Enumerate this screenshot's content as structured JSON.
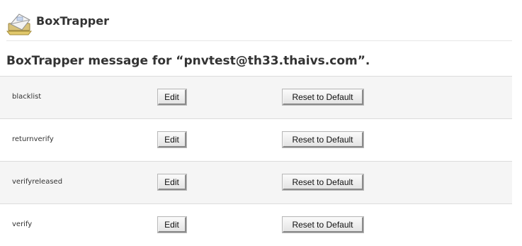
{
  "header": {
    "app_icon": "boxtrapper-envelope-icon",
    "title": "BoxTrapper"
  },
  "page": {
    "title": "BoxTrapper message for “pnvtest@th33.thaivs.com”."
  },
  "messages": [
    {
      "name": "blacklist",
      "edit_label": "Edit",
      "reset_label": "Reset to Default"
    },
    {
      "name": "returnverify",
      "edit_label": "Edit",
      "reset_label": "Reset to Default"
    },
    {
      "name": "verifyreleased",
      "edit_label": "Edit",
      "reset_label": "Reset to Default"
    },
    {
      "name": "verify",
      "edit_label": "Edit",
      "reset_label": "Reset to Default"
    }
  ]
}
